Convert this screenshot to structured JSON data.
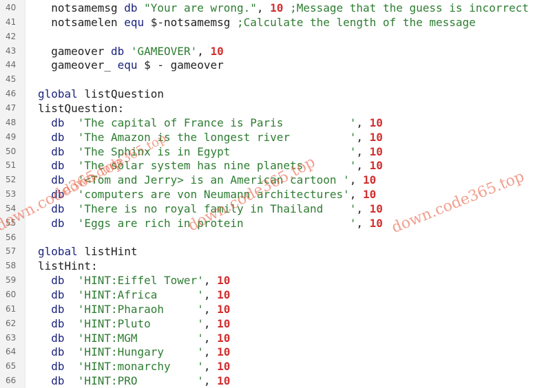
{
  "lines": [
    {
      "n": "40",
      "ind": "  ",
      "toks": [
        [
          "t",
          "notsamemsg "
        ],
        [
          "kw",
          "db "
        ],
        [
          "str",
          "\"Your are wrong.\""
        ],
        [
          "t",
          ", "
        ],
        [
          "num",
          "10"
        ],
        [
          "t",
          " "
        ],
        [
          "cmt",
          ";Message that the guess is incorrect"
        ]
      ]
    },
    {
      "n": "41",
      "ind": "  ",
      "toks": [
        [
          "t",
          "notsamelen "
        ],
        [
          "kw",
          "equ "
        ],
        [
          "t",
          "$-notsamemsg "
        ],
        [
          "cmt",
          ";Calculate the length of the message"
        ]
      ]
    },
    {
      "n": "42",
      "ind": "",
      "toks": []
    },
    {
      "n": "43",
      "ind": "  ",
      "toks": [
        [
          "t",
          "gameover "
        ],
        [
          "kw",
          "db "
        ],
        [
          "str",
          "'GAMEOVER'"
        ],
        [
          "t",
          ", "
        ],
        [
          "num",
          "10"
        ]
      ]
    },
    {
      "n": "44",
      "ind": "  ",
      "toks": [
        [
          "t",
          "gameover_ "
        ],
        [
          "kw",
          "equ "
        ],
        [
          "t",
          "$ - gameover"
        ]
      ]
    },
    {
      "n": "45",
      "ind": "",
      "toks": []
    },
    {
      "n": "46",
      "ind": "",
      "toks": [
        [
          "kw",
          "global "
        ],
        [
          "t",
          "listQuestion"
        ]
      ]
    },
    {
      "n": "47",
      "ind": "",
      "toks": [
        [
          "t",
          "listQuestion:"
        ]
      ]
    },
    {
      "n": "48",
      "ind": "  ",
      "toks": [
        [
          "kw",
          "db  "
        ],
        [
          "str",
          "'The capital of France is Paris          '"
        ],
        [
          "t",
          ", "
        ],
        [
          "num",
          "10"
        ]
      ]
    },
    {
      "n": "49",
      "ind": "  ",
      "toks": [
        [
          "kw",
          "db  "
        ],
        [
          "str",
          "'The Amazon is the longest river         '"
        ],
        [
          "t",
          ", "
        ],
        [
          "num",
          "10"
        ]
      ]
    },
    {
      "n": "50",
      "ind": "  ",
      "toks": [
        [
          "kw",
          "db  "
        ],
        [
          "str",
          "'The Sphinx is in Egypt                  '"
        ],
        [
          "t",
          ", "
        ],
        [
          "num",
          "10"
        ]
      ]
    },
    {
      "n": "51",
      "ind": "  ",
      "toks": [
        [
          "kw",
          "db  "
        ],
        [
          "str",
          "'The solar system has nine planets       '"
        ],
        [
          "t",
          ", "
        ],
        [
          "num",
          "10"
        ]
      ]
    },
    {
      "n": "52",
      "ind": "  ",
      "toks": [
        [
          "kw",
          "db  "
        ],
        [
          "str",
          "'<Tom and Jerry> is an American cartoon '"
        ],
        [
          "t",
          ", "
        ],
        [
          "num",
          "10"
        ]
      ]
    },
    {
      "n": "53",
      "ind": "  ",
      "toks": [
        [
          "kw",
          "db  "
        ],
        [
          "str",
          "'computers are von Neumann architectures'"
        ],
        [
          "t",
          ", "
        ],
        [
          "num",
          "10"
        ]
      ]
    },
    {
      "n": "54",
      "ind": "  ",
      "toks": [
        [
          "kw",
          "db  "
        ],
        [
          "str",
          "'There is no royal family in Thailand    '"
        ],
        [
          "t",
          ", "
        ],
        [
          "num",
          "10"
        ]
      ]
    },
    {
      "n": "55",
      "ind": "  ",
      "toks": [
        [
          "kw",
          "db  "
        ],
        [
          "str",
          "'Eggs are rich in protein                '"
        ],
        [
          "t",
          ", "
        ],
        [
          "num",
          "10"
        ]
      ]
    },
    {
      "n": "56",
      "ind": "",
      "toks": []
    },
    {
      "n": "57",
      "ind": "",
      "toks": [
        [
          "kw",
          "global "
        ],
        [
          "t",
          "listHint"
        ]
      ]
    },
    {
      "n": "58",
      "ind": "",
      "toks": [
        [
          "t",
          "listHint:"
        ]
      ]
    },
    {
      "n": "59",
      "ind": "  ",
      "toks": [
        [
          "kw",
          "db  "
        ],
        [
          "str",
          "'HINT:Eiffel Tower'"
        ],
        [
          "t",
          ", "
        ],
        [
          "num",
          "10"
        ]
      ]
    },
    {
      "n": "60",
      "ind": "  ",
      "toks": [
        [
          "kw",
          "db  "
        ],
        [
          "str",
          "'HINT:Africa      '"
        ],
        [
          "t",
          ", "
        ],
        [
          "num",
          "10"
        ]
      ]
    },
    {
      "n": "61",
      "ind": "  ",
      "toks": [
        [
          "kw",
          "db  "
        ],
        [
          "str",
          "'HINT:Pharaoh     '"
        ],
        [
          "t",
          ", "
        ],
        [
          "num",
          "10"
        ]
      ]
    },
    {
      "n": "62",
      "ind": "  ",
      "toks": [
        [
          "kw",
          "db  "
        ],
        [
          "str",
          "'HINT:Pluto       '"
        ],
        [
          "t",
          ", "
        ],
        [
          "num",
          "10"
        ]
      ]
    },
    {
      "n": "63",
      "ind": "  ",
      "toks": [
        [
          "kw",
          "db  "
        ],
        [
          "str",
          "'HINT:MGM         '"
        ],
        [
          "t",
          ", "
        ],
        [
          "num",
          "10"
        ]
      ]
    },
    {
      "n": "64",
      "ind": "  ",
      "toks": [
        [
          "kw",
          "db  "
        ],
        [
          "str",
          "'HINT:Hungary     '"
        ],
        [
          "t",
          ", "
        ],
        [
          "num",
          "10"
        ]
      ]
    },
    {
      "n": "65",
      "ind": "  ",
      "toks": [
        [
          "kw",
          "db  "
        ],
        [
          "str",
          "'HINT:monarchy    '"
        ],
        [
          "t",
          ", "
        ],
        [
          "num",
          "10"
        ]
      ]
    },
    {
      "n": "66",
      "ind": "  ",
      "toks": [
        [
          "kw",
          "db  "
        ],
        [
          "str",
          "'HINT:PRO         '"
        ],
        [
          "t",
          ", "
        ],
        [
          "num",
          "10"
        ]
      ]
    }
  ],
  "watermarks": [
    "down.code365.top",
    "down.code365.top",
    "down.code365.top",
    "down.code365.top"
  ],
  "colors": {
    "keyword": "#1a237e",
    "string": "#2e7d32",
    "number": "#d32f2f",
    "line_number": "#6b6b6b",
    "watermark": "#e65032"
  }
}
